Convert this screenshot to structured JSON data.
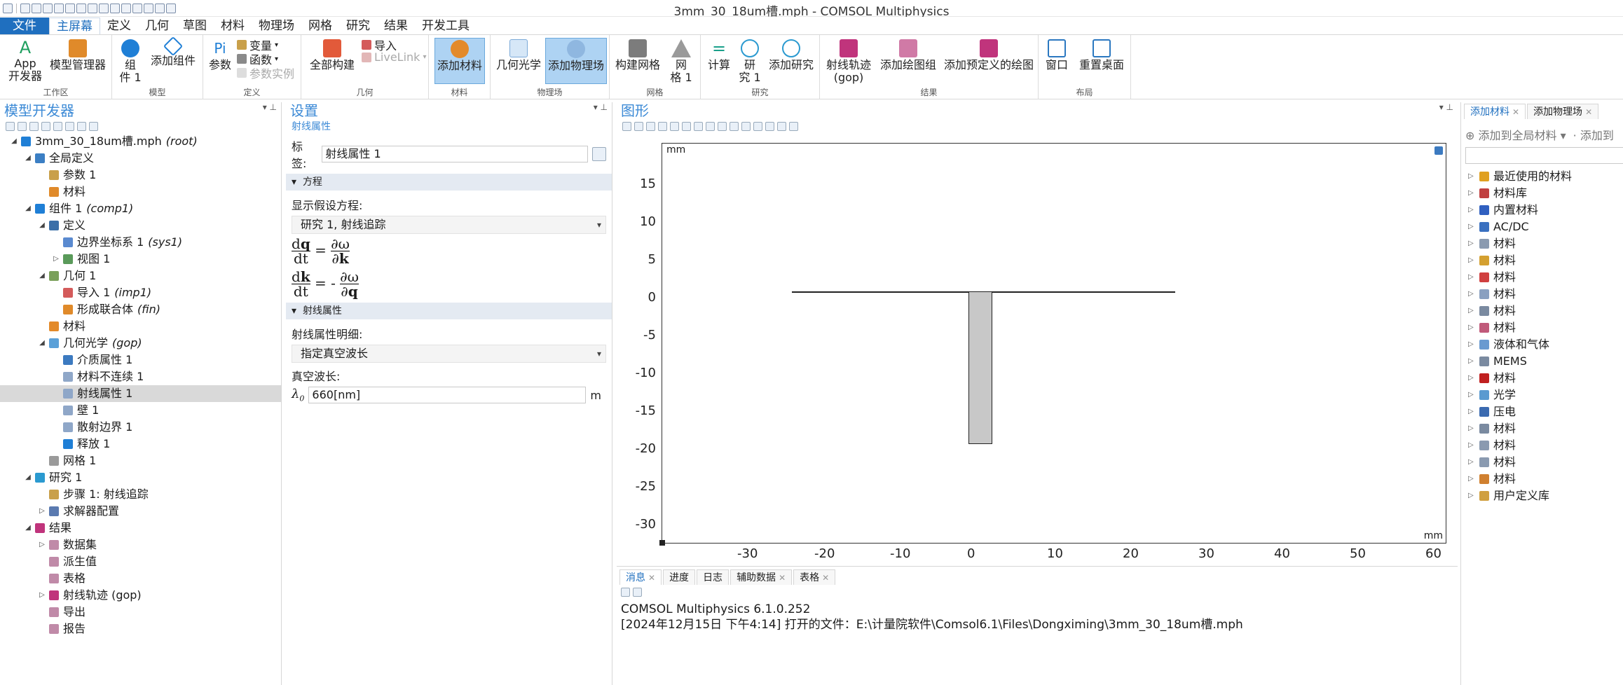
{
  "window": {
    "title": "3mm_30_18um槽.mph - COMSOL Multiphysics"
  },
  "menu": {
    "items": [
      "文件",
      "主屏幕",
      "定义",
      "几何",
      "草图",
      "材料",
      "物理场",
      "网格",
      "研究",
      "结果",
      "开发工具"
    ]
  },
  "ribbon": {
    "groups": [
      "工作区",
      "模型",
      "定义",
      "几何",
      "材料",
      "物理场",
      "网格",
      "研究",
      "结果",
      "布局"
    ],
    "app_dev_1": "App",
    "app_dev_2": "开发器",
    "model_manager": "模型管理器",
    "component_1": "组",
    "component_2": "件 1",
    "add_component": "添加组件",
    "params": "参数",
    "variables": "变量",
    "functions": "函数",
    "param_instance": "参数实例",
    "build_all": "全部构建",
    "import": "导入",
    "livelink": "LiveLink",
    "add_material": "添加材料",
    "geom_optics": "几何光学",
    "add_physics": "添加物理场",
    "build_mesh": "构建网格",
    "mesh_1": "网",
    "mesh_2": "格 1",
    "compute": "计算",
    "study_1": "研",
    "study_2": "究 1",
    "add_study": "添加研究",
    "ray_traj_1": "射线轨迹",
    "ray_traj_2": "(gop)",
    "add_plot_group": "添加绘图组",
    "add_predef_plot": "添加预定义的绘图",
    "window": "窗口",
    "reset_desktop": "重置桌面"
  },
  "model_builder": {
    "title": "模型开发器",
    "tree": [
      {
        "label": "3mm_30_18um槽.mph",
        "tag": "(root)"
      },
      {
        "label": "全局定义",
        "tag": ""
      },
      {
        "label": "参数 1",
        "tag": ""
      },
      {
        "label": "材料",
        "tag": ""
      },
      {
        "label": "组件 1",
        "tag": "(comp1)"
      },
      {
        "label": "定义",
        "tag": ""
      },
      {
        "label": "边界坐标系 1",
        "tag": "(sys1)"
      },
      {
        "label": "视图 1",
        "tag": ""
      },
      {
        "label": "几何 1",
        "tag": ""
      },
      {
        "label": "导入 1",
        "tag": "(imp1)"
      },
      {
        "label": "形成联合体",
        "tag": "(fin)"
      },
      {
        "label": "材料",
        "tag": ""
      },
      {
        "label": "几何光学",
        "tag": "(gop)"
      },
      {
        "label": "介质属性 1",
        "tag": ""
      },
      {
        "label": "材料不连续 1",
        "tag": ""
      },
      {
        "label": "射线属性 1",
        "tag": ""
      },
      {
        "label": "壁 1",
        "tag": ""
      },
      {
        "label": "散射边界 1",
        "tag": ""
      },
      {
        "label": "释放 1",
        "tag": ""
      },
      {
        "label": "网格 1",
        "tag": ""
      },
      {
        "label": "研究 1",
        "tag": ""
      },
      {
        "label": "步骤 1: 射线追踪",
        "tag": ""
      },
      {
        "label": "求解器配置",
        "tag": ""
      },
      {
        "label": "结果",
        "tag": ""
      },
      {
        "label": "数据集",
        "tag": ""
      },
      {
        "label": "派生值",
        "tag": ""
      },
      {
        "label": "表格",
        "tag": ""
      },
      {
        "label": "射线轨迹 (gop)",
        "tag": ""
      },
      {
        "label": "导出",
        "tag": ""
      },
      {
        "label": "报告",
        "tag": ""
      }
    ]
  },
  "settings": {
    "title": "设置",
    "subtitle": "射线属性",
    "label_caption": "标签:",
    "label_value": "射线属性 1",
    "sec_equation": "方程",
    "show_eq_caption": "显示假设方程:",
    "eq_select": "研究 1, 射线追踪",
    "sec_ray": "射线属性",
    "ray_spec_caption": "射线属性明细:",
    "ray_spec": "指定真空波长",
    "vac_wl_caption": "真空波长:",
    "lambda_sym": "λ",
    "lambda_sub": "0",
    "vac_wl_value": "660[nm]",
    "unit": "m"
  },
  "graphics": {
    "title": "图形",
    "unit_tl": "mm",
    "unit_br": "mm",
    "yticks": [
      "15",
      "10",
      "5",
      "0",
      "-5",
      "-10",
      "-15",
      "-20",
      "-25",
      "-30"
    ],
    "xticks": [
      "-30",
      "-20",
      "-10",
      "0",
      "10",
      "20",
      "30",
      "40",
      "50",
      "60"
    ]
  },
  "messages": {
    "tabs": [
      "消息",
      "进度",
      "日志",
      "辅助数据",
      "表格"
    ],
    "line1": "COMSOL Multiphysics 6.1.0.252",
    "line2": "[2024年12月15日 下午4:14] 打开的文件：E:\\计量院软件\\Comsol6.1\\Files\\Dongximing\\3mm_30_18um槽.mph"
  },
  "library": {
    "tabs": [
      "添加材料",
      "添加物理场"
    ],
    "add_global": "添加到全局材料",
    "add_to": "添加到",
    "items": [
      "最近使用的材料",
      "材料库",
      "内置材料",
      "AC/DC",
      "材料",
      "材料",
      "材料",
      "材料",
      "材料",
      "材料",
      "液体和气体",
      "MEMS",
      "材料",
      "光学",
      "压电",
      "材料",
      "材料",
      "材料",
      "材料",
      "用户定义库"
    ]
  },
  "colors": {
    "accent": "#1f6fbf",
    "selected": "#aed3f3",
    "title_blue": "#3c8ad6"
  }
}
